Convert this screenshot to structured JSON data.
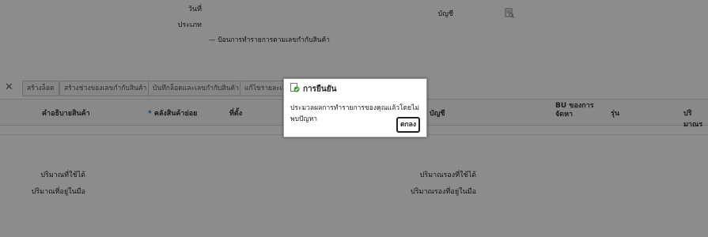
{
  "form": {
    "date_label": "วันที่",
    "type_label": "ประเภท",
    "account_label": "บัญชี",
    "serial_checkbox_label": "ป้อนการทำรายการตามเลขกำกับสินค้า"
  },
  "icons": {
    "close": "close-icon",
    "lookup": "lookup-icon",
    "confirm": "check-shield-icon"
  },
  "toolbar": {
    "buttons": [
      "สร้างล็อต",
      "สร้างช่วงของเลขกำกับสินค้า",
      "บันทึกล็อตและเลขกำกับสินค้า",
      "แก้ไขรายละเอีย"
    ]
  },
  "grid": {
    "columns": [
      "คำอธิบายสินค้า",
      "คลังสินค้าย่อย",
      "ที่ตั้ง",
      "บัญชี",
      "BU ของการ\nจัดหา",
      "รุ่น",
      "ปริมาณร"
    ]
  },
  "summary": {
    "left_available": "ปริมาณที่ใช้ได้",
    "left_onhand": "ปริมาณที่อยู่ในมือ",
    "right_available": "ปริมาณรองที่ใช้ได้",
    "right_onhand": "ปริมาณรองที่อยู่ในมือ"
  },
  "dialog": {
    "title": "การยืนยัน",
    "message": "ประมวลผลการทำรายการของคุณแล้วโดยไม่พบปัญหา",
    "ok_label": "ตกลง"
  },
  "colors": {
    "overlay": "#737373",
    "check_green": "#3c9a2f"
  }
}
